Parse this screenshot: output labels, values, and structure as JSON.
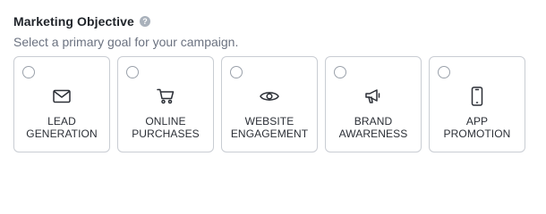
{
  "header": {
    "title": "Marketing Objective",
    "help_glyph": "?",
    "subtitle": "Select a primary goal for your campaign."
  },
  "objectives": [
    {
      "icon": "envelope-icon",
      "line1": "LEAD",
      "line2": "GENERATION",
      "selected": false
    },
    {
      "icon": "shopping-cart-icon",
      "line1": "ONLINE",
      "line2": "PURCHASES",
      "selected": false
    },
    {
      "icon": "eye-icon",
      "line1": "WEBSITE",
      "line2": "ENGAGEMENT",
      "selected": false
    },
    {
      "icon": "megaphone-icon",
      "line1": "BRAND",
      "line2": "AWARENESS",
      "selected": false
    },
    {
      "icon": "mobile-phone-icon",
      "line1": "APP",
      "line2": "PROMOTION",
      "selected": false
    }
  ],
  "colors": {
    "title": "#1f2329",
    "subtitle": "#6b7280",
    "card_border": "#c9cdd3",
    "icon_stroke": "#2b2f36",
    "help_badge": "#a9b1bb"
  }
}
